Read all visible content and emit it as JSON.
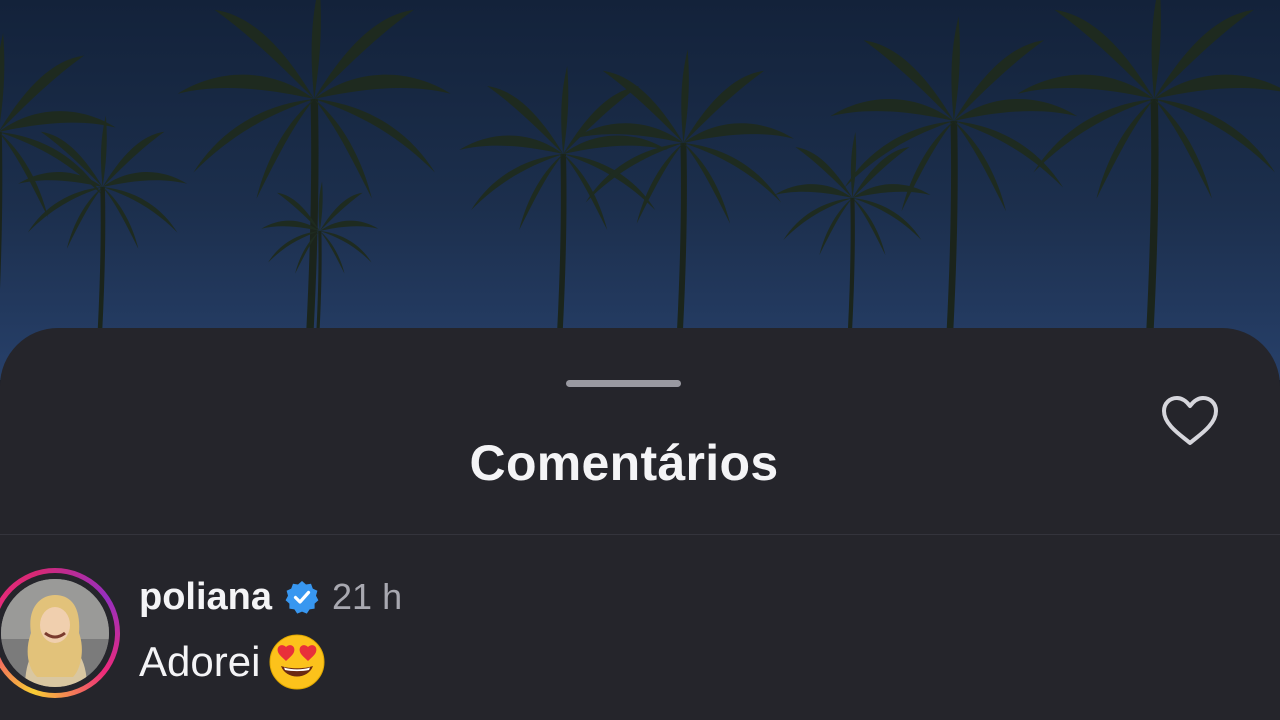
{
  "sheet": {
    "title": "Comentários"
  },
  "comment": {
    "username": "poliana",
    "verified": true,
    "time": "21 h",
    "text": "Adorei",
    "emoji": "heart-eyes-emoji",
    "avatar_ring": "instagram-story-gradient"
  },
  "icons": {
    "verified": "verified-badge-icon",
    "like": "heart-outline-icon"
  },
  "colors": {
    "sheet_bg": "#25252b",
    "text_primary": "#f4f4f6",
    "text_secondary": "#a8a8b0",
    "verified_blue": "#3897f0",
    "ring_gradient": [
      "#f9ce34",
      "#ee2a7b",
      "#962fbf"
    ]
  }
}
